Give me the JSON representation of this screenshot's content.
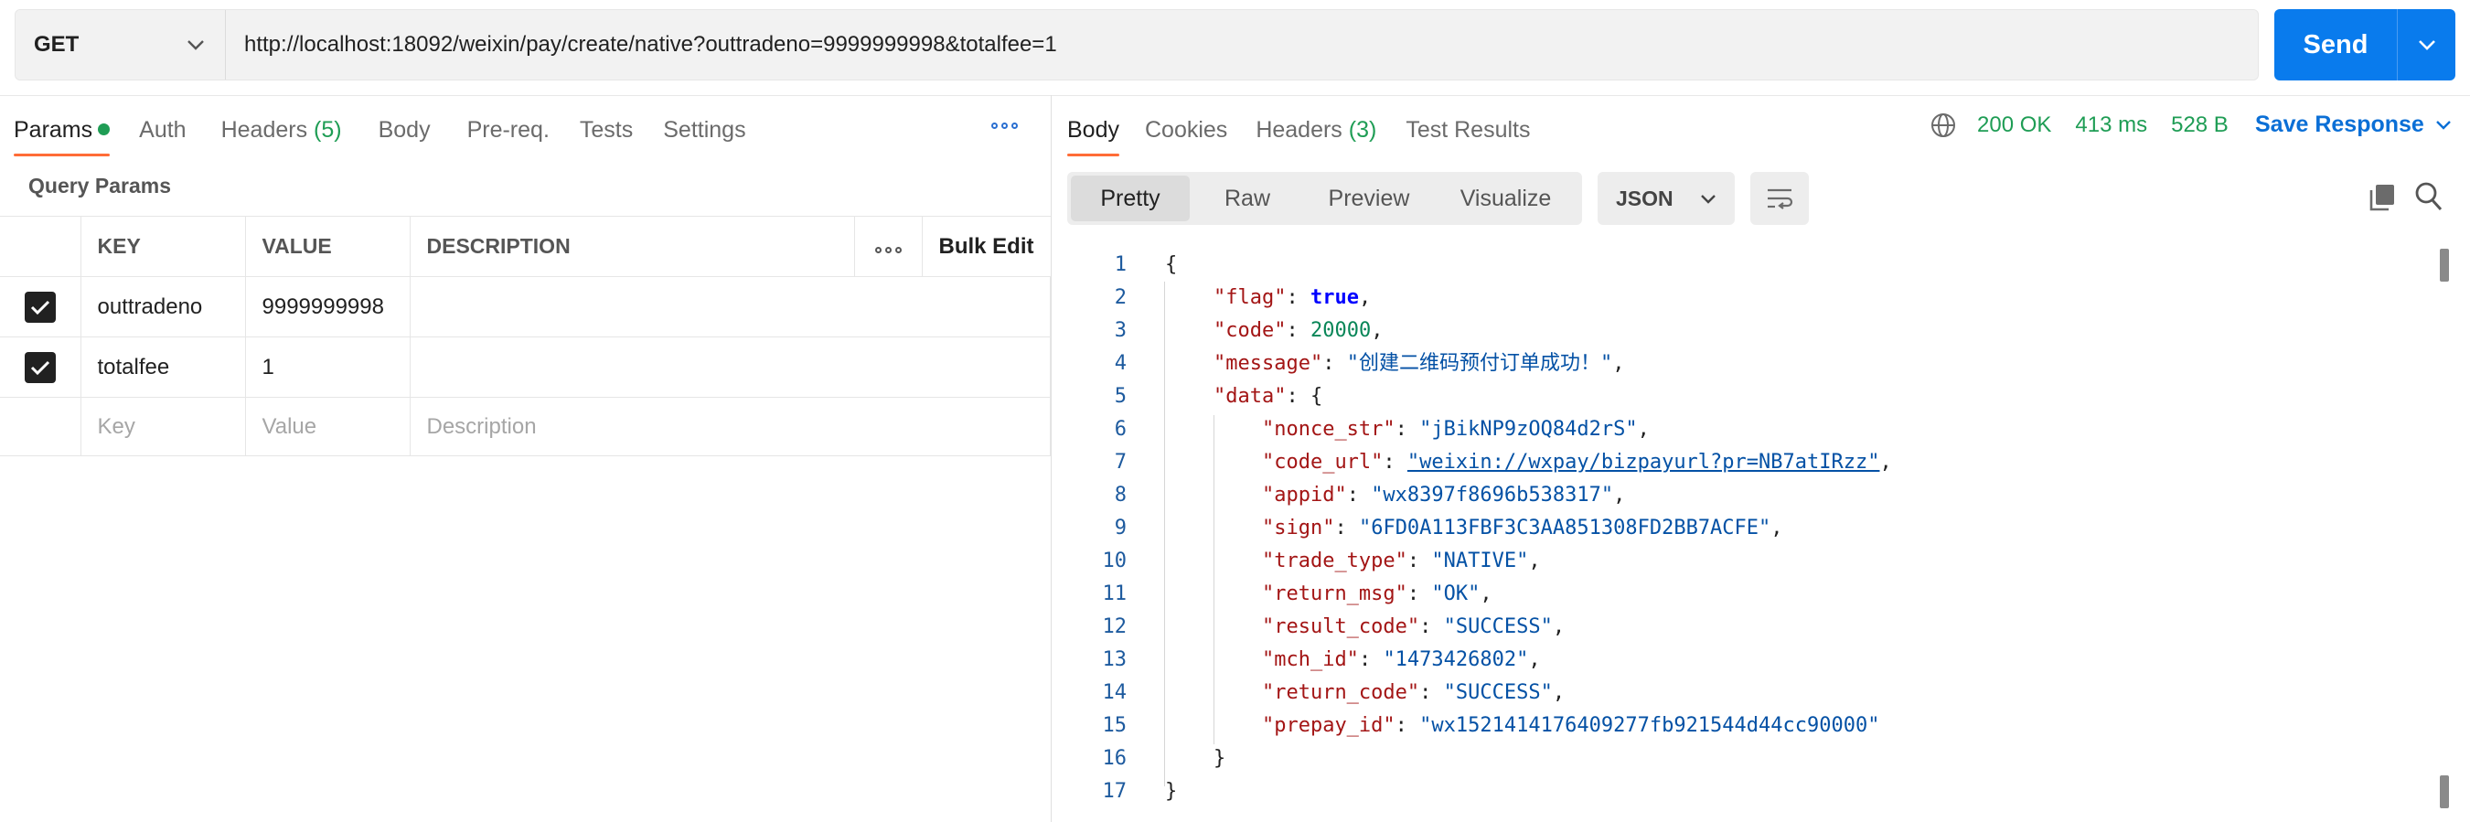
{
  "request": {
    "method": "GET",
    "url": "http://localhost:18092/weixin/pay/create/native?outtradeno=9999999998&totalfee=1",
    "send_label": "Send"
  },
  "left_tabs": {
    "params": "Params",
    "auth": "Auth",
    "headers": "Headers",
    "headers_count": "(5)",
    "body": "Body",
    "prereq": "Pre-req.",
    "tests": "Tests",
    "settings": "Settings"
  },
  "query_params": {
    "title": "Query Params",
    "columns": [
      "KEY",
      "VALUE",
      "DESCRIPTION"
    ],
    "bulk_edit": "Bulk Edit",
    "rows": [
      {
        "key": "outtradeno",
        "value": "9999999998",
        "description": ""
      },
      {
        "key": "totalfee",
        "value": "1",
        "description": ""
      }
    ],
    "placeholder": {
      "key": "Key",
      "value": "Value",
      "description": "Description"
    }
  },
  "response_tabs": {
    "body": "Body",
    "cookies": "Cookies",
    "headers": "Headers",
    "headers_count": "(3)",
    "test_results": "Test Results"
  },
  "response_status": {
    "status": "200 OK",
    "time": "413 ms",
    "size": "528 B",
    "save_label": "Save Response"
  },
  "view_modes": [
    "Pretty",
    "Raw",
    "Preview",
    "Visualize"
  ],
  "format": "JSON",
  "code_lines": [
    {
      "n": "1",
      "parts": [
        [
          "p",
          "{"
        ]
      ]
    },
    {
      "n": "2",
      "parts": [
        [
          "p",
          "    "
        ],
        [
          "k",
          "\"flag\""
        ],
        [
          "p",
          ": "
        ],
        [
          "b",
          "true"
        ],
        [
          "p",
          ","
        ]
      ]
    },
    {
      "n": "3",
      "parts": [
        [
          "p",
          "    "
        ],
        [
          "k",
          "\"code\""
        ],
        [
          "p",
          ": "
        ],
        [
          "n",
          "20000"
        ],
        [
          "p",
          ","
        ]
      ]
    },
    {
      "n": "4",
      "parts": [
        [
          "p",
          "    "
        ],
        [
          "k",
          "\"message\""
        ],
        [
          "p",
          ": "
        ],
        [
          "s",
          "\"创建二维码预付订单成功！\""
        ],
        [
          "p",
          ","
        ]
      ]
    },
    {
      "n": "5",
      "parts": [
        [
          "p",
          "    "
        ],
        [
          "k",
          "\"data\""
        ],
        [
          "p",
          ": {"
        ]
      ]
    },
    {
      "n": "6",
      "parts": [
        [
          "p",
          "        "
        ],
        [
          "k",
          "\"nonce_str\""
        ],
        [
          "p",
          ": "
        ],
        [
          "s",
          "\"jBikNP9zOQ84d2rS\""
        ],
        [
          "p",
          ","
        ]
      ]
    },
    {
      "n": "7",
      "parts": [
        [
          "p",
          "        "
        ],
        [
          "k",
          "\"code_url\""
        ],
        [
          "p",
          ": "
        ],
        [
          "su",
          "\"weixin://wxpay/bizpayurl?pr=NB7atIRzz\""
        ],
        [
          "p",
          ","
        ]
      ]
    },
    {
      "n": "8",
      "parts": [
        [
          "p",
          "        "
        ],
        [
          "k",
          "\"appid\""
        ],
        [
          "p",
          ": "
        ],
        [
          "s",
          "\"wx8397f8696b538317\""
        ],
        [
          "p",
          ","
        ]
      ]
    },
    {
      "n": "9",
      "parts": [
        [
          "p",
          "        "
        ],
        [
          "k",
          "\"sign\""
        ],
        [
          "p",
          ": "
        ],
        [
          "s",
          "\"6FD0A113FBF3C3AA851308FD2BB7ACFE\""
        ],
        [
          "p",
          ","
        ]
      ]
    },
    {
      "n": "10",
      "parts": [
        [
          "p",
          "        "
        ],
        [
          "k",
          "\"trade_type\""
        ],
        [
          "p",
          ": "
        ],
        [
          "s",
          "\"NATIVE\""
        ],
        [
          "p",
          ","
        ]
      ]
    },
    {
      "n": "11",
      "parts": [
        [
          "p",
          "        "
        ],
        [
          "k",
          "\"return_msg\""
        ],
        [
          "p",
          ": "
        ],
        [
          "s",
          "\"OK\""
        ],
        [
          "p",
          ","
        ]
      ]
    },
    {
      "n": "12",
      "parts": [
        [
          "p",
          "        "
        ],
        [
          "k",
          "\"result_code\""
        ],
        [
          "p",
          ": "
        ],
        [
          "s",
          "\"SUCCESS\""
        ],
        [
          "p",
          ","
        ]
      ]
    },
    {
      "n": "13",
      "parts": [
        [
          "p",
          "        "
        ],
        [
          "k",
          "\"mch_id\""
        ],
        [
          "p",
          ": "
        ],
        [
          "s",
          "\"1473426802\""
        ],
        [
          "p",
          ","
        ]
      ]
    },
    {
      "n": "14",
      "parts": [
        [
          "p",
          "        "
        ],
        [
          "k",
          "\"return_code\""
        ],
        [
          "p",
          ": "
        ],
        [
          "s",
          "\"SUCCESS\""
        ],
        [
          "p",
          ","
        ]
      ]
    },
    {
      "n": "15",
      "parts": [
        [
          "p",
          "        "
        ],
        [
          "k",
          "\"prepay_id\""
        ],
        [
          "p",
          ": "
        ],
        [
          "s",
          "\"wx1521414176409277fb921544d44cc90000\""
        ]
      ]
    },
    {
      "n": "16",
      "parts": [
        [
          "p",
          "    }"
        ]
      ]
    },
    {
      "n": "17",
      "parts": [
        [
          "p",
          "}"
        ]
      ]
    }
  ],
  "colors": {
    "accent_orange": "#ff6c37",
    "send_blue": "#097bed",
    "status_green": "#1f9d55",
    "link_blue": "#0b6fd6"
  }
}
